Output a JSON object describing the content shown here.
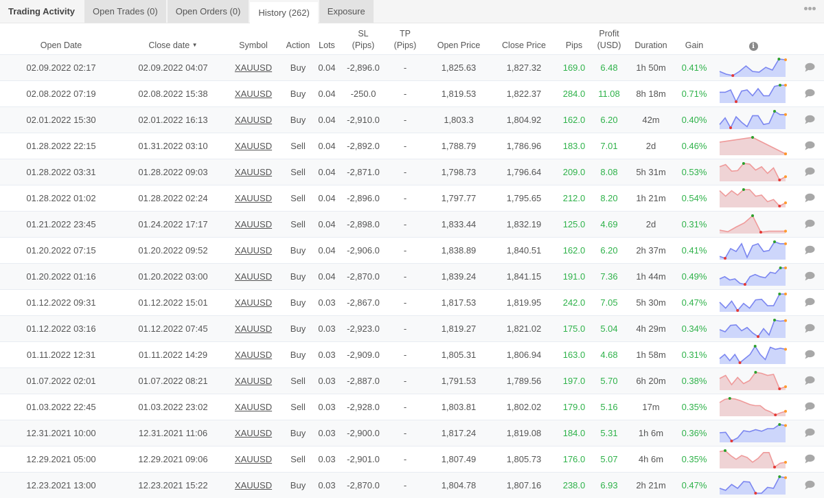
{
  "tabs": {
    "title": "Trading Activity",
    "items": [
      {
        "label": "Open Trades (0)",
        "active": false
      },
      {
        "label": "Open Orders (0)",
        "active": false
      },
      {
        "label": "History (262)",
        "active": true
      },
      {
        "label": "Exposure",
        "active": false
      }
    ],
    "more_icon": "ellipsis-icon"
  },
  "colors": {
    "buy_line": "#7b86f0",
    "buy_fill": "#cdd6fb",
    "sell_line": "#ef9a9a",
    "sell_fill": "#efd3d5",
    "high_dot": "#2ca02c",
    "low_dot": "#e53935",
    "close_dot": "#ff9a2e",
    "positive": "#2fb24a"
  },
  "headers": {
    "open_date": "Open Date",
    "close_date": "Close date",
    "sort_indicator": "▼",
    "symbol": "Symbol",
    "action": "Action",
    "lots": "Lots",
    "sl_1": "SL",
    "sl_2": "(Pips)",
    "tp_1": "TP",
    "tp_2": "(Pips)",
    "open_price": "Open Price",
    "close_price": "Close Price",
    "pips": "Pips",
    "profit_1": "Profit",
    "profit_2": "(USD)",
    "duration": "Duration",
    "gain": "Gain",
    "info_icon": "i"
  },
  "rows": [
    {
      "open_date": "02.09.2022 02:17",
      "close_date": "02.09.2022 04:07",
      "symbol": "XAUUSD",
      "action": "Buy",
      "lots": "0.04",
      "sl": "-2,896.0",
      "tp": "-",
      "open_price": "1,825.63",
      "close_price": "1,827.32",
      "pips": "169.0",
      "profit": "6.48",
      "duration": "1h 50m",
      "gain": "0.41%",
      "spark": [
        5,
        3,
        2,
        5,
        9,
        5,
        4.5,
        8,
        6,
        14,
        13.5
      ],
      "hi": 9,
      "lo": 2
    },
    {
      "open_date": "02.08.2022 07:19",
      "close_date": "02.08.2022 15:38",
      "symbol": "XAUUSD",
      "action": "Buy",
      "lots": "0.04",
      "sl": "-250.0",
      "tp": "-",
      "open_price": "1,819.53",
      "close_price": "1,822.37",
      "pips": "284.0",
      "profit": "11.08",
      "duration": "8h 18m",
      "gain": "0.71%",
      "spark": [
        9,
        9,
        11,
        1,
        10,
        11,
        6,
        12,
        6,
        6,
        14,
        15,
        15
      ],
      "hi": 11,
      "lo": 3
    },
    {
      "open_date": "02.01.2022 15:30",
      "close_date": "02.01.2022 16:13",
      "symbol": "XAUUSD",
      "action": "Buy",
      "lots": "0.04",
      "sl": "-2,910.0",
      "tp": "-",
      "open_price": "1,803.3",
      "close_price": "1,804.92",
      "pips": "162.0",
      "profit": "6.20",
      "duration": "42m",
      "gain": "0.40%",
      "spark": [
        4,
        10,
        1,
        11,
        6,
        2,
        12,
        12,
        4,
        5,
        16,
        13,
        13
      ],
      "hi": 10,
      "lo": 2
    },
    {
      "open_date": "01.28.2022 22:15",
      "close_date": "01.31.2022 03:10",
      "symbol": "XAUUSD",
      "action": "Sell",
      "lots": "0.04",
      "sl": "-2,892.0",
      "tp": "-",
      "open_price": "1,788.79",
      "close_price": "1,786.96",
      "pips": "183.0",
      "profit": "7.01",
      "duration": "2d",
      "gain": "0.46%",
      "spark": [
        10,
        14,
        0
      ],
      "hi": 1,
      "lo": 2
    },
    {
      "open_date": "01.28.2022 03:31",
      "close_date": "01.28.2022 09:03",
      "symbol": "XAUUSD",
      "action": "Sell",
      "lots": "0.04",
      "sl": "-2,871.0",
      "tp": "-",
      "open_price": "1,798.73",
      "close_price": "1,796.64",
      "pips": "209.0",
      "profit": "8.08",
      "duration": "5h 31m",
      "gain": "0.53%",
      "spark": [
        12,
        14,
        8,
        8.5,
        15,
        14.5,
        9,
        12,
        6,
        11,
        0,
        3
      ],
      "hi": 4,
      "lo": 10
    },
    {
      "open_date": "01.28.2022 01:02",
      "close_date": "01.28.2022 02:24",
      "symbol": "XAUUSD",
      "action": "Sell",
      "lots": "0.04",
      "sl": "-2,896.0",
      "tp": "-",
      "open_price": "1,797.77",
      "close_price": "1,795.65",
      "pips": "212.0",
      "profit": "8.20",
      "duration": "1h 21m",
      "gain": "0.54%",
      "spark": [
        14,
        9,
        14,
        10,
        15,
        15,
        9,
        10,
        4,
        6,
        0,
        3
      ],
      "hi": 4,
      "lo": 10
    },
    {
      "open_date": "01.21.2022 23:45",
      "close_date": "01.24.2022 17:17",
      "symbol": "XAUUSD",
      "action": "Sell",
      "lots": "0.04",
      "sl": "-2,898.0",
      "tp": "-",
      "open_price": "1,833.44",
      "close_price": "1,832.19",
      "pips": "125.0",
      "profit": "4.69",
      "duration": "2d",
      "gain": "0.31%",
      "spark": [
        2,
        0.5,
        5,
        9,
        16,
        0,
        1,
        1,
        1
      ],
      "hi": 4,
      "lo": 5
    },
    {
      "open_date": "01.20.2022 07:15",
      "close_date": "01.20.2022 09:52",
      "symbol": "XAUUSD",
      "action": "Buy",
      "lots": "0.04",
      "sl": "-2,906.0",
      "tp": "-",
      "open_price": "1,838.89",
      "close_price": "1,840.51",
      "pips": "162.0",
      "profit": "6.20",
      "duration": "2h 37m",
      "gain": "0.41%",
      "spark": [
        2,
        0,
        10,
        7,
        15,
        1,
        13,
        15,
        7,
        8,
        17,
        15,
        15
      ],
      "hi": 10,
      "lo": 1
    },
    {
      "open_date": "01.20.2022 01:16",
      "close_date": "01.20.2022 03:00",
      "symbol": "XAUUSD",
      "action": "Buy",
      "lots": "0.04",
      "sl": "-2,870.0",
      "tp": "-",
      "open_price": "1,839.24",
      "close_price": "1,841.15",
      "pips": "191.0",
      "profit": "7.36",
      "duration": "1h 44m",
      "gain": "0.49%",
      "spark": [
        5,
        7,
        4,
        5,
        1,
        0,
        7,
        9,
        7,
        6,
        11,
        10,
        15,
        15
      ],
      "hi": 12,
      "lo": 5
    },
    {
      "open_date": "01.12.2022 09:31",
      "close_date": "01.12.2022 15:01",
      "symbol": "XAUUSD",
      "action": "Buy",
      "lots": "0.03",
      "sl": "-2,867.0",
      "tp": "-",
      "open_price": "1,817.53",
      "close_price": "1,819.95",
      "pips": "242.0",
      "profit": "7.05",
      "duration": "5h 30m",
      "gain": "0.47%",
      "spark": [
        7,
        2,
        8,
        0,
        6,
        2,
        9,
        9.5,
        4,
        4,
        14,
        14
      ],
      "hi": 10,
      "lo": 3
    },
    {
      "open_date": "01.12.2022 03:16",
      "close_date": "01.12.2022 07:45",
      "symbol": "XAUUSD",
      "action": "Buy",
      "lots": "0.03",
      "sl": "-2,923.0",
      "tp": "-",
      "open_price": "1,819.27",
      "close_price": "1,821.02",
      "pips": "175.0",
      "profit": "5.04",
      "duration": "4h 29m",
      "gain": "0.34%",
      "spark": [
        7,
        5,
        11,
        11.5,
        6,
        9,
        4,
        0.5,
        8,
        2,
        16,
        15,
        15.5
      ],
      "hi": 10,
      "lo": 7
    },
    {
      "open_date": "01.11.2022 12:31",
      "close_date": "01.11.2022 14:29",
      "symbol": "XAUUSD",
      "action": "Buy",
      "lots": "0.03",
      "sl": "-2,909.0",
      "tp": "-",
      "open_price": "1,805.31",
      "close_price": "1,806.94",
      "pips": "163.0",
      "profit": "4.68",
      "duration": "1h 58m",
      "gain": "0.31%",
      "spark": [
        4,
        8,
        2,
        8,
        0,
        4,
        8,
        16,
        8,
        3,
        15,
        13,
        14,
        13
      ],
      "hi": 7,
      "lo": 4
    },
    {
      "open_date": "01.07.2022 02:01",
      "close_date": "01.07.2022 08:21",
      "symbol": "XAUUSD",
      "action": "Sell",
      "lots": "0.03",
      "sl": "-2,887.0",
      "tp": "-",
      "open_price": "1,791.53",
      "close_price": "1,789.56",
      "pips": "197.0",
      "profit": "5.70",
      "duration": "6h 20m",
      "gain": "0.38%",
      "spark": [
        11,
        14,
        5,
        12,
        6,
        9,
        17,
        16,
        14,
        15,
        1,
        3
      ],
      "hi": 6,
      "lo": 10
    },
    {
      "open_date": "01.03.2022 22:45",
      "close_date": "01.03.2022 23:02",
      "symbol": "XAUUSD",
      "action": "Sell",
      "lots": "0.03",
      "sl": "-2,928.0",
      "tp": "-",
      "open_price": "1,803.81",
      "close_price": "1,802.02",
      "pips": "179.0",
      "profit": "5.16",
      "duration": "17m",
      "gain": "0.35%",
      "spark": [
        12,
        15,
        16,
        15.5,
        14,
        12,
        10,
        9,
        9,
        5,
        3,
        0,
        2,
        3.5
      ],
      "hi": 2,
      "lo": 11
    },
    {
      "open_date": "12.31.2021 10:00",
      "close_date": "12.31.2021 11:06",
      "symbol": "XAUUSD",
      "action": "Buy",
      "lots": "0.03",
      "sl": "-2,900.0",
      "tp": "-",
      "open_price": "1,817.24",
      "close_price": "1,819.08",
      "pips": "184.0",
      "profit": "5.31",
      "duration": "1h 6m",
      "gain": "0.36%",
      "spark": [
        8,
        8.5,
        0,
        3,
        10,
        9,
        11,
        9.5,
        12,
        12,
        16,
        15
      ],
      "hi": 10,
      "lo": 2
    },
    {
      "open_date": "12.29.2021 05:00",
      "close_date": "12.29.2021 09:06",
      "symbol": "XAUUSD",
      "action": "Sell",
      "lots": "0.03",
      "sl": "-2,901.0",
      "tp": "-",
      "open_price": "1,807.49",
      "close_price": "1,805.73",
      "pips": "176.0",
      "profit": "5.07",
      "duration": "4h 6m",
      "gain": "0.35%",
      "spark": [
        16,
        17,
        12,
        8,
        12,
        10,
        5,
        9,
        15,
        15,
        0,
        4,
        5
      ],
      "hi": 1,
      "lo": 10
    },
    {
      "open_date": "12.23.2021 13:00",
      "close_date": "12.23.2021 15:22",
      "symbol": "XAUUSD",
      "action": "Buy",
      "lots": "0.03",
      "sl": "-2,870.0",
      "tp": "-",
      "open_price": "1,804.78",
      "close_price": "1,807.16",
      "pips": "238.0",
      "profit": "6.93",
      "duration": "2h 21m",
      "gain": "0.47%",
      "spark": [
        5,
        3,
        9,
        5,
        12,
        11.5,
        0,
        0,
        6,
        5,
        17,
        16
      ],
      "hi": 10,
      "lo": 6
    }
  ],
  "comment_icon": "speech-bubble-icon"
}
